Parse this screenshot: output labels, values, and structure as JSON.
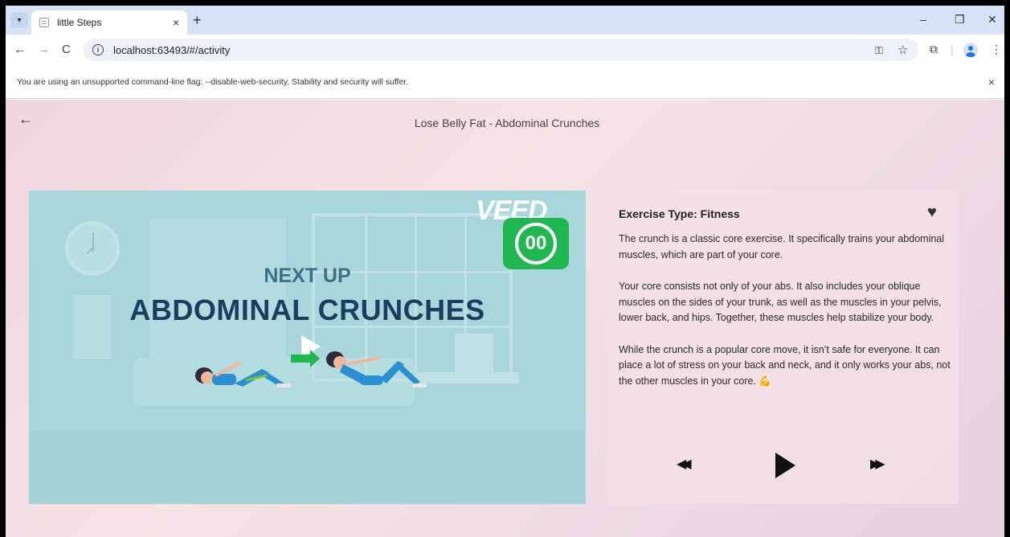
{
  "browser": {
    "tab_title": "little Steps",
    "tab_close": "×",
    "new_tab": "+",
    "url": "localhost:63493/#/activity",
    "infobar_message": "You are using an unsupported command-line flag: --disable-web-security. Stability and security will suffer.",
    "infobar_close": "×",
    "minimize": "–",
    "restore": "❐",
    "close": "✕",
    "back": "←",
    "forward": "→",
    "reload": "C"
  },
  "app": {
    "back": "←",
    "page_title": "Lose Belly Fat - Abdominal Crunches"
  },
  "video": {
    "watermark_text": "VEED",
    "watermark_badge": "00",
    "next_up_label": "NEXT UP",
    "exercise_name": "ABDOMINAL CRUNCHES"
  },
  "card": {
    "title": "Exercise Type: Fitness",
    "favorite_icon": "heart-icon",
    "paragraphs": [
      "The crunch is a classic core exercise. It specifically trains your abdominal muscles, which are part of your core.",
      "Your core consists not only of your abs. It also includes your oblique muscles on the sides of your trunk, as well as the muscles in your pelvis, lower back, and hips. Together, these muscles help stabilize your body.",
      "While the crunch is a popular core move, it isn’t safe for everyone. It can place a lot of stress on your back and neck, and it only works your abs, not the other muscles in your core. 💪"
    ]
  },
  "colors": {
    "video_bg": "#a9d6da",
    "accent_green": "#1fb74f",
    "title_navy": "#1c3d5e"
  }
}
